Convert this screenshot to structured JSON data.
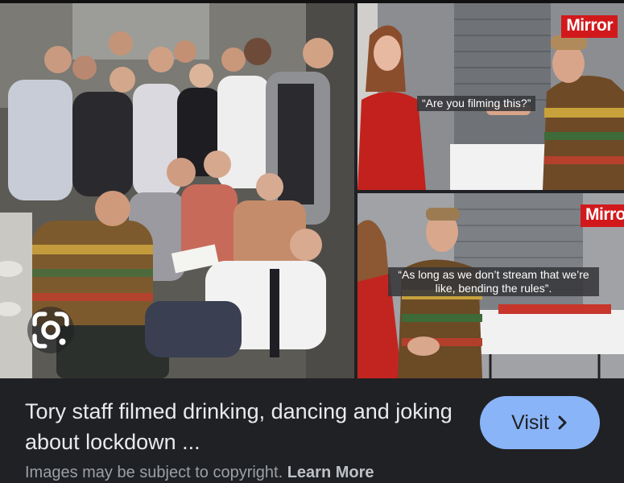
{
  "images": {
    "top_right": {
      "badge": "Mirror",
      "caption": "“Are you filming this?”"
    },
    "bottom_right": {
      "badge": "Mirro",
      "caption": "“As long as we don’t stream that we’re like, bending the rules”."
    }
  },
  "lens": {
    "icon": "google-lens-icon"
  },
  "result": {
    "title": "Tory staff filmed drinking, dancing and joking about lockdown ...",
    "visit_label": "Visit",
    "visit_icon": "chevron-right-icon"
  },
  "footer": {
    "notice": "Images may be subject to copyright.",
    "learn_more": "Learn More"
  },
  "colors": {
    "background": "#202124",
    "visit_button": "#8ab4f8",
    "mirror_red": "#d1191c"
  }
}
